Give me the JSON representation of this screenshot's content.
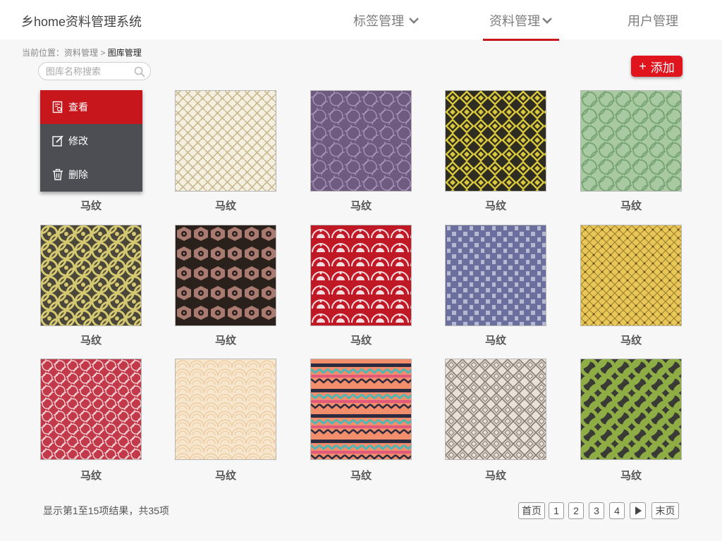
{
  "header": {
    "app_title": "乡home资料管理系统",
    "nav": [
      {
        "label": "标签管理",
        "has_dropdown": true,
        "active": false
      },
      {
        "label": "资料管理",
        "has_dropdown": true,
        "active": true
      },
      {
        "label": "用户管理",
        "has_dropdown": false,
        "active": false
      }
    ]
  },
  "breadcrumb": {
    "prefix": "当前位置：",
    "parent": "资料管理",
    "separator": ">",
    "current": "图库管理"
  },
  "search": {
    "placeholder": "图库名称搜索",
    "value": ""
  },
  "add_button": {
    "label": "添加"
  },
  "tile_menu": {
    "items": [
      {
        "label": "查看",
        "icon": "view-icon",
        "active": true
      },
      {
        "label": "修改",
        "icon": "edit-icon",
        "active": false
      },
      {
        "label": "删除",
        "icon": "trash-icon",
        "active": false
      }
    ]
  },
  "gallery": {
    "items": [
      {
        "caption": "马纹",
        "pattern": "red-waves"
      },
      {
        "caption": "马纹",
        "pattern": "cream-lattice"
      },
      {
        "caption": "马纹",
        "pattern": "purple-circles"
      },
      {
        "caption": "马纹",
        "pattern": "yellow-diamonds"
      },
      {
        "caption": "马纹",
        "pattern": "green-circles"
      },
      {
        "caption": "马纹",
        "pattern": "olive-flowers"
      },
      {
        "caption": "马纹",
        "pattern": "brown-hexagons"
      },
      {
        "caption": "马纹",
        "pattern": "red-fans"
      },
      {
        "caption": "马纹",
        "pattern": "blue-weave"
      },
      {
        "caption": "马纹",
        "pattern": "yellow-grid"
      },
      {
        "caption": "马纹",
        "pattern": "red-rings"
      },
      {
        "caption": "马纹",
        "pattern": "peach-waves"
      },
      {
        "caption": "马纹",
        "pattern": "tribal-stripes"
      },
      {
        "caption": "马纹",
        "pattern": "grey-braid"
      },
      {
        "caption": "马纹",
        "pattern": "green-circles-dark"
      }
    ]
  },
  "footer": {
    "summary": "显示第1至15项结果，共35项",
    "pager": {
      "first": "首页",
      "pages": [
        "1",
        "2",
        "3",
        "4"
      ],
      "next_icon": "play-icon",
      "last": "末页"
    }
  },
  "colors": {
    "accent": "#c8161d",
    "add_button": "#e0141d",
    "menu_bg": "#4d4e54"
  }
}
